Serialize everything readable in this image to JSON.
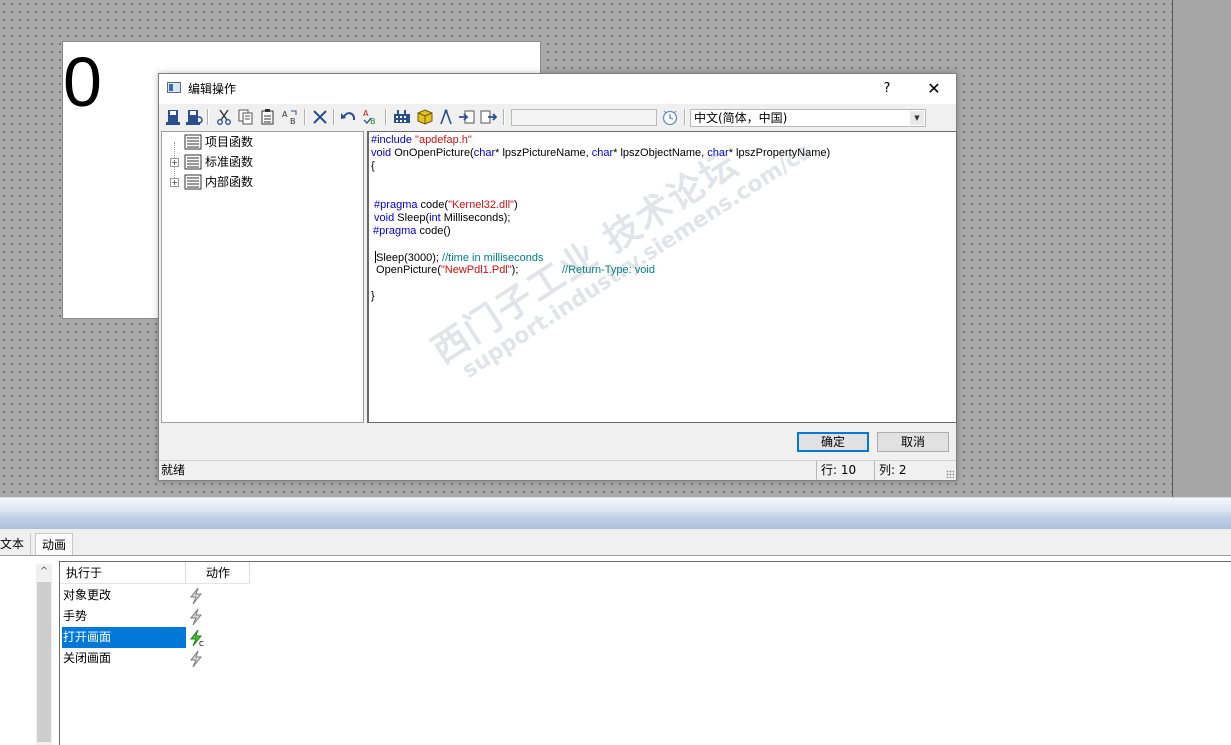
{
  "canvas": {
    "value": "0"
  },
  "dialog": {
    "title": "编辑操作",
    "help_label": "?",
    "close_label": "✕",
    "toolbar_icons": [
      "save-icon",
      "save-as-icon",
      "cut-icon",
      "copy-icon",
      "paste-icon",
      "replace-icon",
      "delete-icon",
      "undo-icon",
      "spellcheck-icon",
      "grid-icon",
      "cube-icon",
      "compass-icon",
      "import-icon",
      "export-icon",
      "clock-icon"
    ],
    "combo_blank": "",
    "language": "中文(简体，中国)",
    "tree": [
      {
        "label": "项目函数",
        "expandable": false
      },
      {
        "label": "标准函数",
        "expandable": true
      },
      {
        "label": "内部函数",
        "expandable": true
      }
    ],
    "code": {
      "l1_kw": "#include ",
      "l1_str": "\"apdefap.h\"",
      "l2_kw1": "void",
      "l2_t1": " OnOpenPicture(",
      "l2_kw2": "char",
      "l2_t2": "* lpszPictureName, ",
      "l2_kw3": "char",
      "l2_t3": "* lpszObjectName, ",
      "l2_kw4": "char",
      "l2_t4": "* lpszPropertyName)",
      "l3": "{",
      "l4_kw": " #pragma",
      "l4_t1": " code(",
      "l4_str": "\"Kernel32.dll\"",
      "l4_t2": ")",
      "l5_kw1": " void",
      "l5_t1": " Sleep(",
      "l5_kw2": "int",
      "l5_t2": " Milliseconds);",
      "l6_kw": "#pragma",
      "l6_t1": " code()",
      "l7_t1": "Sleep(3000); ",
      "l7_cm": "//time in milliseconds",
      "l8_t1": " OpenPicture(",
      "l8_str": "\"NewPdl1.Pdl\"",
      "l8_t2": ");",
      "l8_cm": "//Return-Type: void",
      "l9": "}"
    },
    "ok_label": "确定",
    "cancel_label": "取消",
    "status": "就绪",
    "row_label": "行:  10",
    "col_label": "列:  2"
  },
  "bottom": {
    "tabs": [
      "文本",
      "动画"
    ],
    "columns": [
      "执行于",
      "动作"
    ],
    "events": [
      {
        "label": "对象更改",
        "active": false
      },
      {
        "label": "手势",
        "active": false
      },
      {
        "label": "打开画面",
        "active": true
      },
      {
        "label": "关闭画面",
        "active": false
      }
    ],
    "scroll_up": "^"
  },
  "watermark": {
    "line1": "西门子工业  技术论坛",
    "line2": "support.industry.siemens.com/cs"
  },
  "colors": {
    "selection": "#0078d7",
    "keyword": "#0000cc",
    "string": "#cc1111",
    "comment": "#008080"
  }
}
